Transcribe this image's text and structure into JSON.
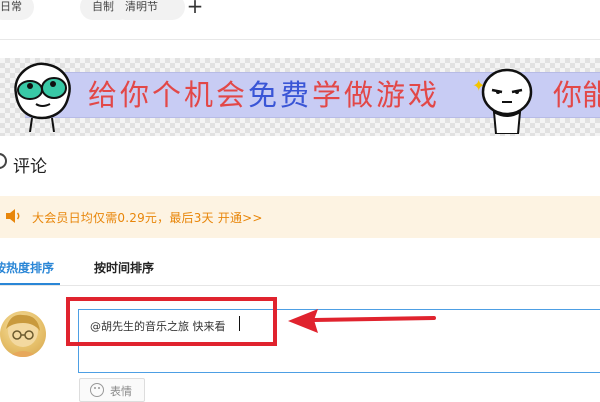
{
  "tags": {
    "items": [
      {
        "label": "日常"
      },
      {
        "label": "自制"
      },
      {
        "label": "清明节"
      }
    ],
    "add_symbol": "+"
  },
  "banner": {
    "segments": [
      {
        "text": "给你个机会",
        "color": "#e24848"
      },
      {
        "text": "免费",
        "color": "#3a55d6"
      },
      {
        "text": "学做游戏",
        "color": "#e24848"
      }
    ],
    "tail": "你能",
    "left_face_icon": "green-alien-face-icon",
    "right_face_icon": "smug-face-icon",
    "sparkle_icon": "sparkle-icon",
    "badge": "ad"
  },
  "comments": {
    "title": "评论"
  },
  "vip_notice": {
    "icon": "speaker-icon",
    "text": "大会员日均仅需0.29元，最后3天 开通>>",
    "color": "#e8860a"
  },
  "sort_tabs": {
    "hot": "按热度排序",
    "time": "按时间排序",
    "active_color": "#2a86d6"
  },
  "comment_input": {
    "value": "@胡先生的音乐之旅 快来看",
    "border_color": "#4d9fe4"
  },
  "annotation": {
    "color": "#e0232e"
  },
  "emoji_button": {
    "label": "表情"
  }
}
